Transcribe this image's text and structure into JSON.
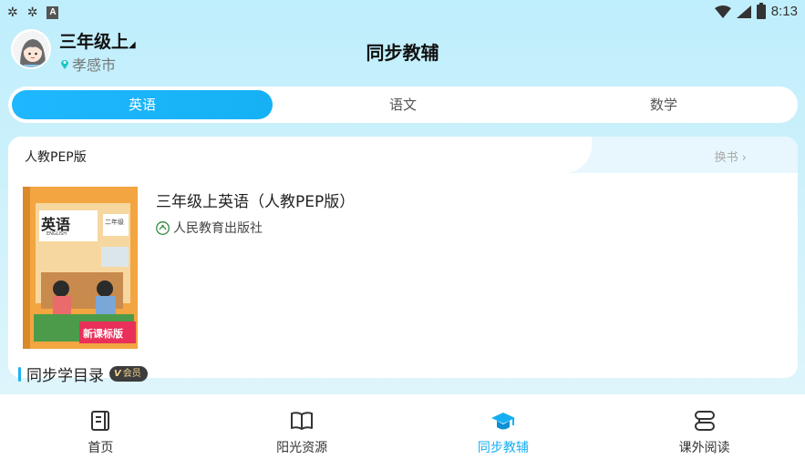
{
  "status_bar": {
    "time": "8:13",
    "app_badge": "A"
  },
  "header": {
    "grade": "三年级上",
    "location": "孝感市",
    "title": "同步教辅"
  },
  "subject_tabs": [
    {
      "label": "英语",
      "active": true
    },
    {
      "label": "语文",
      "active": false
    },
    {
      "label": "数学",
      "active": false
    }
  ],
  "book_card": {
    "edition": "人教PEP版",
    "switch_label": "换书 ›",
    "book_name": "三年级上英语（人教PEP版）",
    "publisher": "人民教育出版社",
    "cover": {
      "title": "英语",
      "subtitle": "ENGLISH",
      "grade_tag": "二年级",
      "ribbon": "新课标版"
    }
  },
  "catalog": {
    "label": "同步学目录",
    "badge": "会员"
  },
  "bottom_nav": [
    {
      "label": "首页",
      "icon": "home-book-icon",
      "active": false
    },
    {
      "label": "阳光资源",
      "icon": "open-book-icon",
      "active": false
    },
    {
      "label": "同步教辅",
      "icon": "graduation-cap-icon",
      "active": true
    },
    {
      "label": "课外阅读",
      "icon": "scroll-icon",
      "active": false
    }
  ],
  "colors": {
    "accent": "#16aef3",
    "vip_text": "#f3d38c"
  }
}
